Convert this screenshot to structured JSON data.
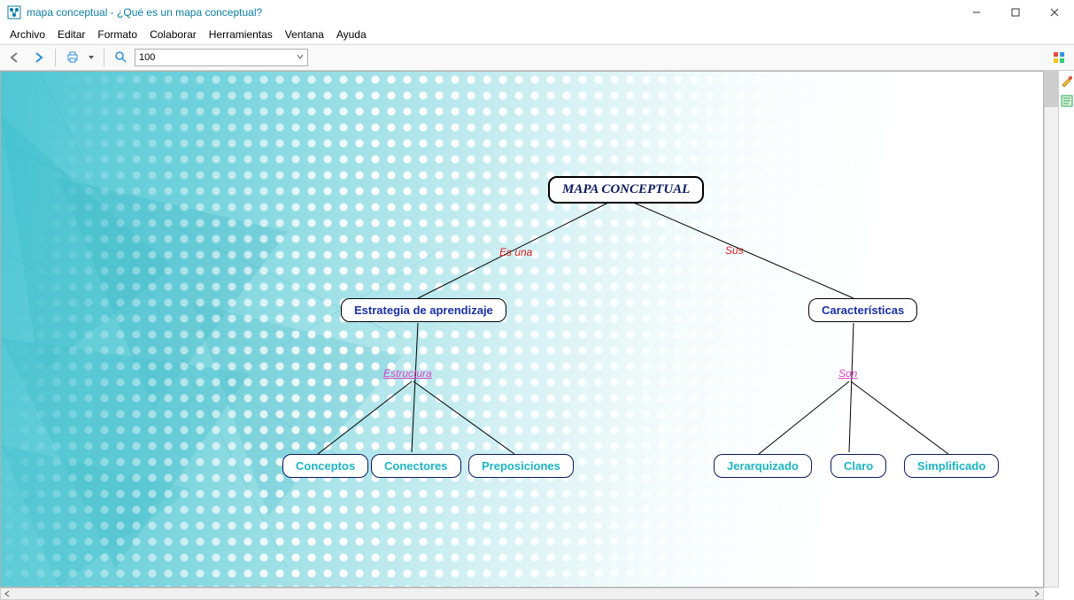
{
  "window": {
    "title": "mapa conceptual - ¿Qué es un mapa conceptual?"
  },
  "menu": {
    "items": [
      "Archivo",
      "Editar",
      "Formato",
      "Colaborar",
      "Herramientas",
      "Ventana",
      "Ayuda"
    ]
  },
  "toolbar": {
    "zoom_value": "100"
  },
  "diagram": {
    "root": "MAPA CONCEPTUAL",
    "link_esuna": "Es una",
    "link_sus": "Sus",
    "node_estrategia": "Estrategia de aprendizaje",
    "node_caracteristicas": "Características",
    "link_estructura": "Estructura",
    "link_son": "Son",
    "node_conceptos": "Conceptos",
    "node_conectores": "Conectores",
    "node_preposiciones": "Preposiciones",
    "node_jerarquizado": "Jerarquizado",
    "node_claro": "Claro",
    "node_simplificado": "Simplificado"
  }
}
